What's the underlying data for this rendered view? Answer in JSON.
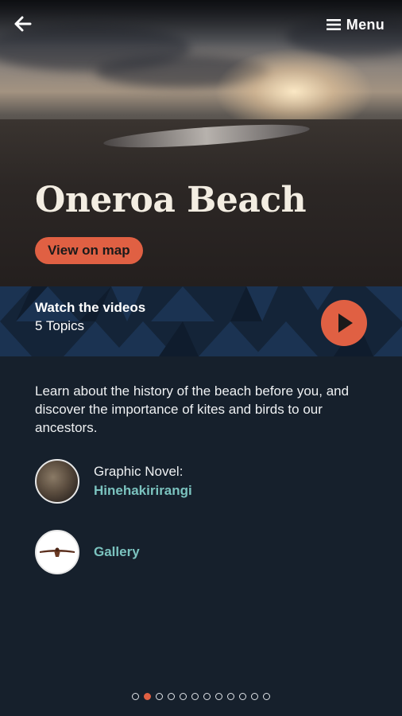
{
  "header": {
    "back_icon": "arrow-left-icon",
    "menu_icon": "hamburger-icon",
    "menu_label": "Menu"
  },
  "hero": {
    "title": "Oneroa Beach",
    "map_button_label": "View on map"
  },
  "videos": {
    "heading": "Watch the videos",
    "topics": "5 Topics",
    "play_icon": "play-icon"
  },
  "description": "Learn about the history of the beach before you, and discover the importance of kites and birds to our ancestors.",
  "links": {
    "graphic_novel": {
      "caption": "Graphic Novel:",
      "title": "Hinehakirirangi"
    },
    "gallery": {
      "title": "Gallery"
    }
  },
  "pagination": {
    "total": 12,
    "current": 2
  },
  "colors": {
    "background": "#16202c",
    "accent": "#e06043",
    "link": "#7bc3bf",
    "band": "#142438"
  }
}
